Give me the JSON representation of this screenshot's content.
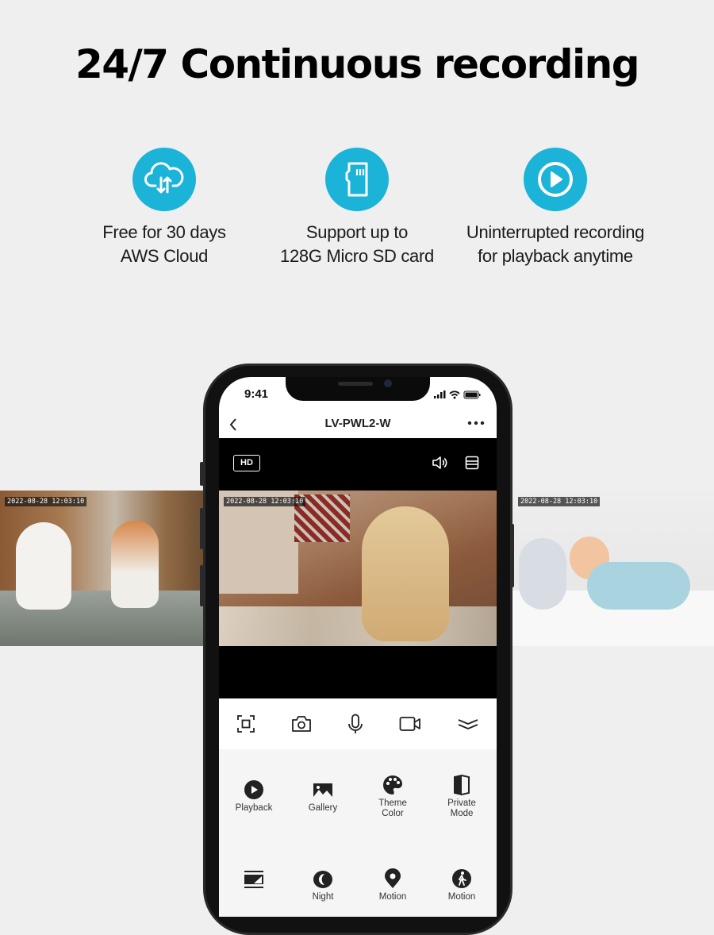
{
  "headline": "24/7 Continuous recording",
  "accent_color": "#1bb3d8",
  "features": [
    {
      "icon": "cloud-sync-icon",
      "line1": "Free for 30 days",
      "line2": "AWS Cloud"
    },
    {
      "icon": "micro-sd-card-icon",
      "line1": "Support up to",
      "line2": "128G Micro SD card"
    },
    {
      "icon": "play-circle-icon",
      "line1": "Uninterrupted recording",
      "line2": "for playback anytime"
    }
  ],
  "side_feeds": {
    "left": {
      "timestamp": "2022-08-28  12:03:10",
      "subject": "kittens playing"
    },
    "right": {
      "timestamp": "2022-08-28  12:03:10",
      "subject": "baby on bed"
    }
  },
  "phone": {
    "status_time": "9:41",
    "device_name": "LV-PWL2-W",
    "quality_badge": "HD",
    "live_timestamp": "2022-08-28  12:03:10",
    "controls": [
      "screenshot-frame-icon",
      "camera-icon",
      "microphone-icon",
      "video-record-icon",
      "collapse-chevron-icon"
    ],
    "grid": [
      {
        "icon": "playback-icon",
        "label": "Playback"
      },
      {
        "icon": "gallery-icon",
        "label": "Gallery"
      },
      {
        "icon": "palette-icon",
        "label": "Theme Color"
      },
      {
        "icon": "private-mode-icon",
        "label": "Private Mode"
      },
      {
        "icon": "osd-icon",
        "label": ""
      },
      {
        "icon": "night-icon",
        "label": "Night"
      },
      {
        "icon": "location-pin-icon",
        "label": "Motion"
      },
      {
        "icon": "walking-person-icon",
        "label": "Motion"
      }
    ]
  }
}
